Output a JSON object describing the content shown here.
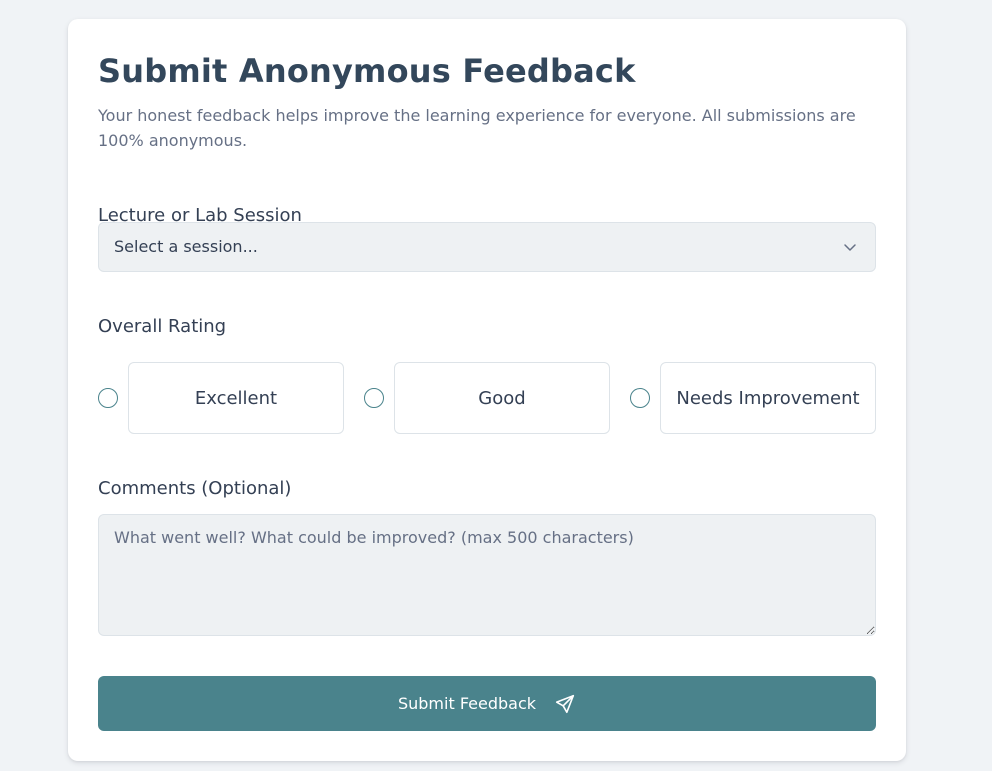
{
  "form": {
    "title": "Submit Anonymous Feedback",
    "intro": "Your honest feedback helps improve the learning experience for everyone. All submissions are 100% anonymous.",
    "session": {
      "label": "Lecture or Lab Session",
      "selected": "Select a session...",
      "icon": "chevron-down-icon"
    },
    "rating": {
      "label": "Overall Rating",
      "options": [
        {
          "label": "Excellent",
          "selected": false
        },
        {
          "label": "Good",
          "selected": false
        },
        {
          "label": "Needs Improvement",
          "selected": false
        }
      ]
    },
    "comments": {
      "label": "Comments (Optional)",
      "value": "",
      "placeholder": "What went well? What could be improved? (max 500 characters)"
    },
    "submit": {
      "label": "Submit Feedback",
      "icon": "send-icon"
    }
  },
  "colors": {
    "background": "#f0f3f6",
    "card": "#ffffff",
    "accent": "#4a838c",
    "heading": "#33475b",
    "text": "#344054",
    "muted": "#667085",
    "input_fill": "#eef1f3",
    "border": "#dde3e8"
  }
}
